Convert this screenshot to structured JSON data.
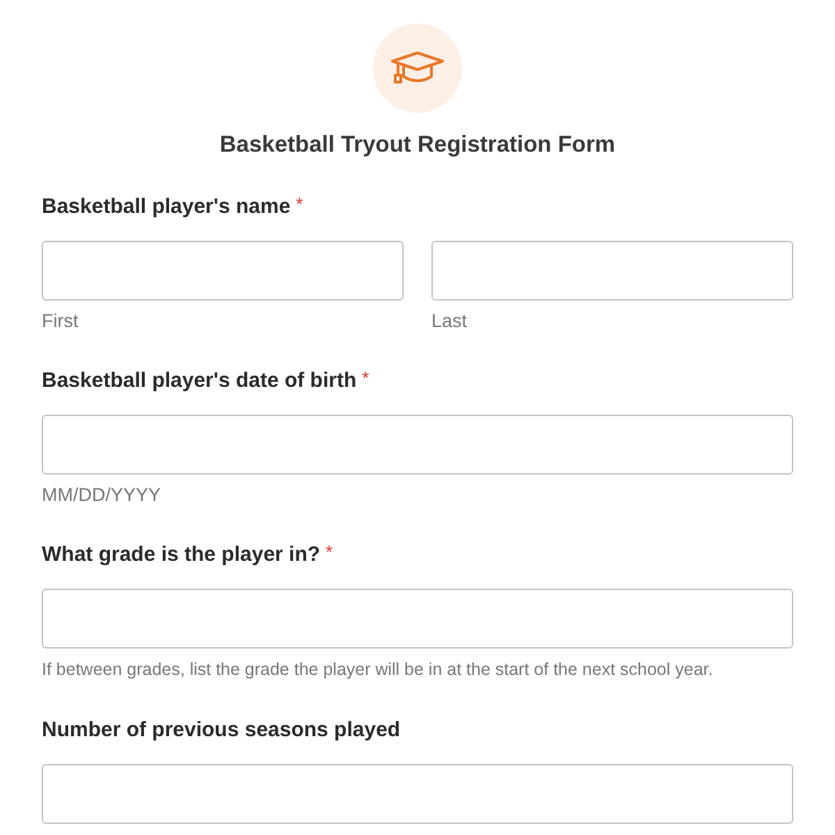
{
  "form": {
    "title": "Basketball Tryout Registration Form"
  },
  "fields": [
    {
      "label": "Basketball player's name",
      "required_mark": "*",
      "sublabels": [
        "First",
        "Last"
      ]
    },
    {
      "label": "Basketball player's date of birth",
      "required_mark": "*",
      "sublabels": [
        "MM/DD/YYYY"
      ]
    },
    {
      "label": "What grade is the player in?",
      "required_mark": "*",
      "hint": "If between grades, list the grade the player will be in at the start of the next school year."
    },
    {
      "label": "Number of previous seasons played"
    }
  ]
}
